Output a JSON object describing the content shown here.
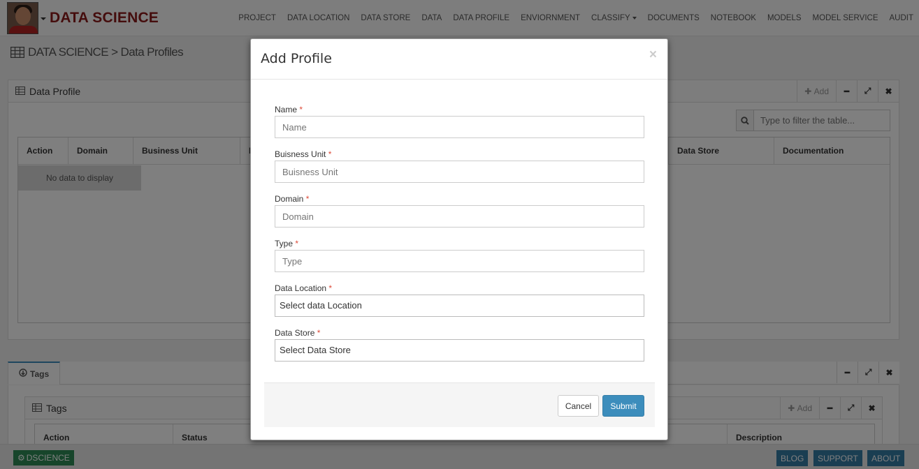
{
  "app": {
    "brand": "DATA SCIENCE"
  },
  "nav": {
    "items": [
      {
        "label": "PROJECT"
      },
      {
        "label": "DATA LOCATION"
      },
      {
        "label": "DATA STORE"
      },
      {
        "label": "DATA"
      },
      {
        "label": "DATA PROFILE"
      },
      {
        "label": "ENVIORNMENT"
      },
      {
        "label": "CLASSIFY",
        "dropdown": true
      },
      {
        "label": "DOCUMENTS"
      },
      {
        "label": "NOTEBOOK"
      },
      {
        "label": "MODELS"
      },
      {
        "label": "MODEL SERVICE"
      },
      {
        "label": "AUDIT"
      }
    ]
  },
  "breadcrumb": {
    "text": "DATA SCIENCE > Data Profiles"
  },
  "data_profile_panel": {
    "title": "Data Profile",
    "add_label": "Add",
    "filter_placeholder": "Type to filter the table...",
    "columns": [
      "Action",
      "Domain",
      "Business Unit",
      "N",
      "Data Store",
      "Documentation"
    ],
    "empty_text": "No data to display"
  },
  "tags_panel": {
    "tab_label": "Tags",
    "title": "Tags",
    "add_label": "Add",
    "columns": [
      "Action",
      "Status",
      "Description"
    ]
  },
  "modal": {
    "title": "Add Profile",
    "close_symbol": "×",
    "fields": [
      {
        "label": "Name",
        "placeholder": "Name"
      },
      {
        "label": "Buisness Unit",
        "placeholder": "Buisness Unit"
      },
      {
        "label": "Domain",
        "placeholder": "Domain"
      },
      {
        "label": "Type",
        "placeholder": "Type"
      },
      {
        "label": "Data Location",
        "value": "Select data Location"
      },
      {
        "label": "Data Store",
        "value": "Select Data Store"
      }
    ],
    "required_mark": "*",
    "cancel_label": "Cancel",
    "submit_label": "Submit"
  },
  "footer": {
    "badge": "DSCIENCE",
    "links": [
      {
        "label": "BLOG"
      },
      {
        "label": "SUPPORT"
      },
      {
        "label": "ABOUT"
      }
    ]
  },
  "colors": {
    "brand": "#8b1a1a",
    "primary": "#3c8dbc",
    "badge": "#2e8b57",
    "required": "#dd4b39"
  },
  "icons": [
    "user-avatar",
    "caret-down-icon",
    "table-icon",
    "plus-icon",
    "minus-icon",
    "expand-icon",
    "close-icon",
    "search-icon",
    "download-circle-icon",
    "gears-icon"
  ]
}
